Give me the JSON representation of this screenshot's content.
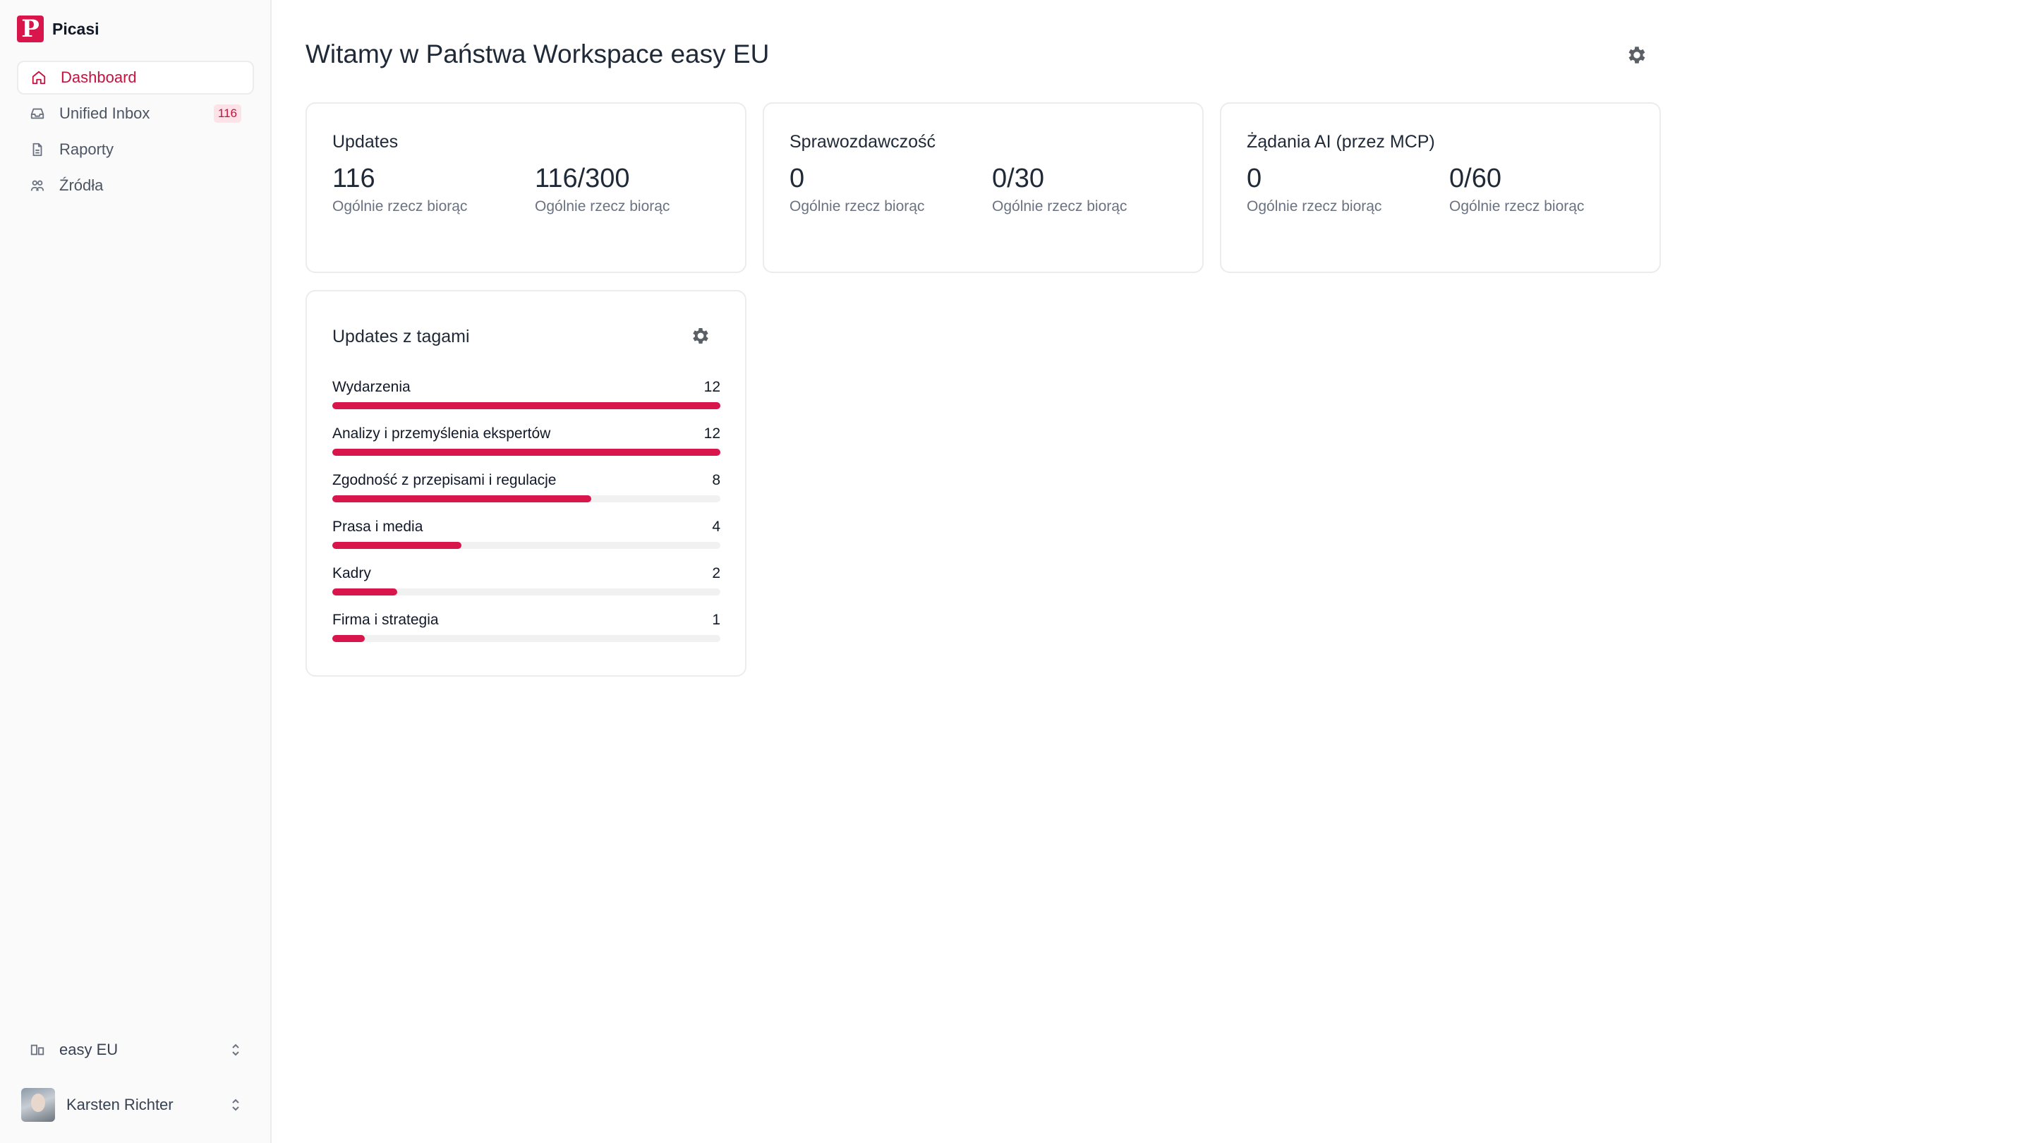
{
  "brand": {
    "name": "Picasi",
    "logo_letter": "P",
    "accent_color": "#d8164c"
  },
  "sidebar": {
    "items": [
      {
        "label": "Dashboard",
        "icon": "home-icon",
        "active": true
      },
      {
        "label": "Unified Inbox",
        "icon": "inbox-icon",
        "badge": "116"
      },
      {
        "label": "Raporty",
        "icon": "file-icon"
      },
      {
        "label": "Źródła",
        "icon": "sources-icon"
      }
    ],
    "workspace": {
      "label": "easy EU",
      "icon": "workspace-icon"
    },
    "user": {
      "name": "Karsten Richter"
    }
  },
  "header": {
    "title": "Witamy w Państwa Workspace easy EU"
  },
  "cards": [
    {
      "title": "Updates",
      "metrics": [
        {
          "value": "116",
          "label": "Ogólnie rzecz biorąc"
        },
        {
          "value": "116/300",
          "label": "Ogólnie rzecz biorąc"
        }
      ]
    },
    {
      "title": "Sprawozdawczość",
      "metrics": [
        {
          "value": "0",
          "label": "Ogólnie rzecz biorąc"
        },
        {
          "value": "0/30",
          "label": "Ogólnie rzecz biorąc"
        }
      ]
    },
    {
      "title": "Żądania AI (przez MCP)",
      "metrics": [
        {
          "value": "0",
          "label": "Ogólnie rzecz biorąc"
        },
        {
          "value": "0/60",
          "label": "Ogólnie rzecz biorąc"
        }
      ]
    }
  ],
  "tags_card": {
    "title": "Updates z tagami",
    "max": 12,
    "tags": [
      {
        "label": "Wydarzenia",
        "count": 12
      },
      {
        "label": "Analizy i przemyślenia ekspertów",
        "count": 12
      },
      {
        "label": "Zgodność z przepisami i regulacje",
        "count": 8
      },
      {
        "label": "Prasa i media",
        "count": 4
      },
      {
        "label": "Kadry",
        "count": 2
      },
      {
        "label": "Firma i strategia",
        "count": 1
      }
    ]
  }
}
